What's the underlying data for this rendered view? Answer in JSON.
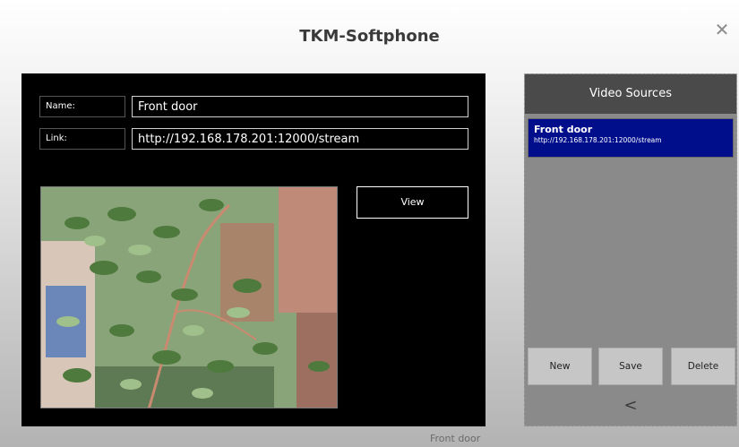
{
  "window": {
    "title": "TKM-Softphone",
    "close_glyph": "✕",
    "close_icon": "close-icon"
  },
  "editor": {
    "name_label": "Name:",
    "name_value": "Front door",
    "link_label": "Link:",
    "link_value": "http://192.168.178.201:12000/stream",
    "view_label": "View",
    "caption": "Front door"
  },
  "sources": {
    "header": "Video Sources",
    "items": [
      {
        "name": "Front door",
        "link": "http://192.168.178.201:12000/stream",
        "selected": true
      }
    ],
    "new_label": "New",
    "save_label": "Save",
    "delete_label": "Delete",
    "back_label": "<",
    "back_icon": "chevron-left-icon"
  },
  "colors": {
    "selected": "#000e8c",
    "panel": "#8a8a8a",
    "header": "#4a4a4a",
    "editor_bg": "#000000"
  }
}
